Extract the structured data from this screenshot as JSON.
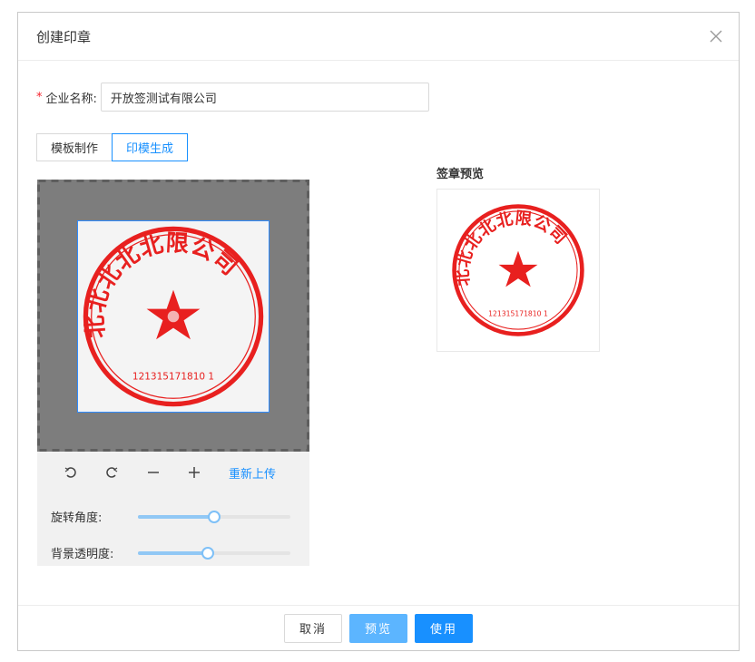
{
  "dialog": {
    "title": "创建印章"
  },
  "form": {
    "required_mark": "*",
    "company_label": "企业名称:",
    "company_value": "开放签测试有限公司"
  },
  "tabs": [
    {
      "label": "模板制作",
      "active": false
    },
    {
      "label": "印模生成",
      "active": true
    }
  ],
  "seal": {
    "arc_text": "北北北北北限公司",
    "serial": "121315171810 1",
    "color": "#e8201f"
  },
  "editor": {
    "tools": [
      "rotate-left-icon",
      "rotate-right-icon",
      "zoom-out-icon",
      "zoom-in-icon"
    ],
    "reupload_label": "重新上传",
    "rotate_label": "旋转角度:",
    "rotate_value": 0.5,
    "opacity_label": "背景透明度:",
    "opacity_value": 0.46
  },
  "preview": {
    "label": "签章预览"
  },
  "footer": {
    "cancel": "取消",
    "preview": "预览",
    "use": "使用"
  },
  "colors": {
    "primary": "#1890ff",
    "seal_red": "#e8201f"
  }
}
